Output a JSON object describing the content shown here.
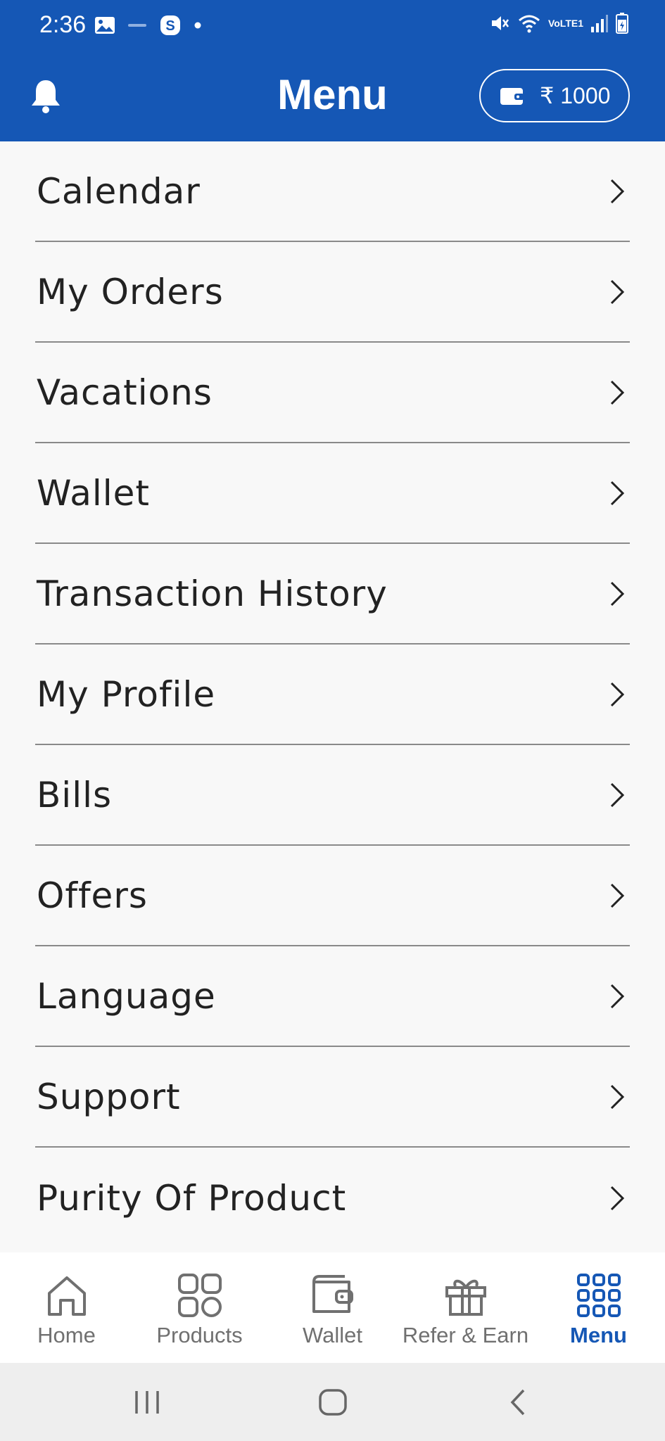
{
  "status_bar": {
    "time": "2:36",
    "network_label": "VoLTE1"
  },
  "header": {
    "title": "Menu",
    "wallet_amount": "₹ 1000"
  },
  "menu": {
    "items": [
      {
        "label": "Calendar"
      },
      {
        "label": "My Orders"
      },
      {
        "label": "Vacations"
      },
      {
        "label": "Wallet"
      },
      {
        "label": "Transaction History"
      },
      {
        "label": "My Profile"
      },
      {
        "label": "Bills"
      },
      {
        "label": "Offers"
      },
      {
        "label": "Language"
      },
      {
        "label": "Support"
      },
      {
        "label": "Purity Of Product"
      }
    ]
  },
  "bottom_nav": {
    "items": [
      {
        "label": "Home",
        "icon": "home-icon"
      },
      {
        "label": "Products",
        "icon": "products-icon"
      },
      {
        "label": "Wallet",
        "icon": "wallet-icon"
      },
      {
        "label": "Refer & Earn",
        "icon": "gift-icon"
      },
      {
        "label": "Menu",
        "icon": "menu-grid-icon",
        "active": true
      }
    ]
  },
  "colors": {
    "primary": "#1557b5",
    "background": "#f8f8f8",
    "text": "#222222",
    "inactive": "#707070"
  }
}
